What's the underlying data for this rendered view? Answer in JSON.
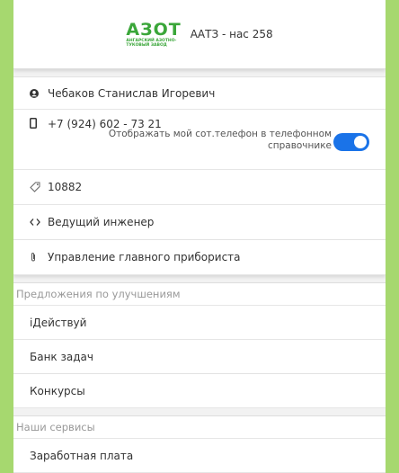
{
  "header": {
    "logo_main": "АЗОТ",
    "logo_sub": "АНГАРСКИЙ АЗОТНО-ТУКОВЫЙ ЗАВОД",
    "title": "AАТЗ - нас 258"
  },
  "profile": {
    "name": "Чебаков Станислав Игоревич",
    "phone": "+7 (924) 602 - 73 21",
    "share_phone_label": "Отображать мой сот.телефон в телефонном справочнике",
    "share_phone_enabled": true,
    "tab_number": "10882",
    "position": "Ведущий инженер",
    "department": "Управление главного прибориста"
  },
  "improvements": {
    "title": "Предложения по улучшениям",
    "items": [
      "iДействуй",
      "Банк задач",
      "Конкурсы"
    ]
  },
  "services": {
    "title": "Наши сервисы",
    "items": [
      "Заработная плата"
    ]
  },
  "colors": {
    "background": "#a6d86f",
    "brand": "#3aa639",
    "toggle_on": "#1a73e8"
  }
}
